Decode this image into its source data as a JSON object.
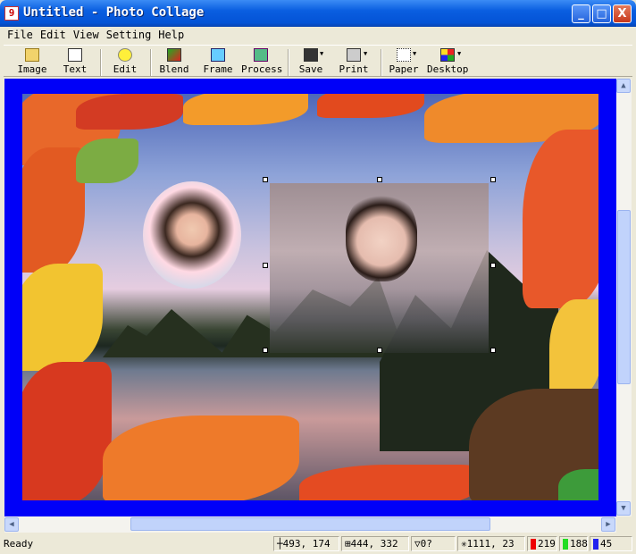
{
  "window": {
    "title": "Untitled - Photo Collage",
    "minimize": "_",
    "maximize": "□",
    "close": "X"
  },
  "menu": [
    "File",
    "Edit",
    "View",
    "Setting",
    "Help"
  ],
  "toolbar": [
    {
      "label": "Image",
      "icon": "open-folder-icon"
    },
    {
      "label": "Text",
      "icon": "text-icon"
    },
    {
      "label": "Edit",
      "icon": "lightbulb-icon"
    },
    {
      "label": "Blend",
      "icon": "blend-icon"
    },
    {
      "label": "Frame",
      "icon": "frame-icon"
    },
    {
      "label": "Process",
      "icon": "process-icon"
    },
    {
      "label": "Save",
      "icon": "floppy-disk-icon"
    },
    {
      "label": "Print",
      "icon": "printer-icon"
    },
    {
      "label": "Paper",
      "icon": "paper-icon"
    },
    {
      "label": "Desktop",
      "icon": "desktop-icon"
    }
  ],
  "canvas": {
    "background": "#0000f8"
  },
  "status": {
    "text": "Ready",
    "position": "493, 174",
    "size": "444, 332",
    "angle": "0?",
    "cursor": "1111, 23",
    "red": "219",
    "green": "188",
    "blue": "45"
  }
}
